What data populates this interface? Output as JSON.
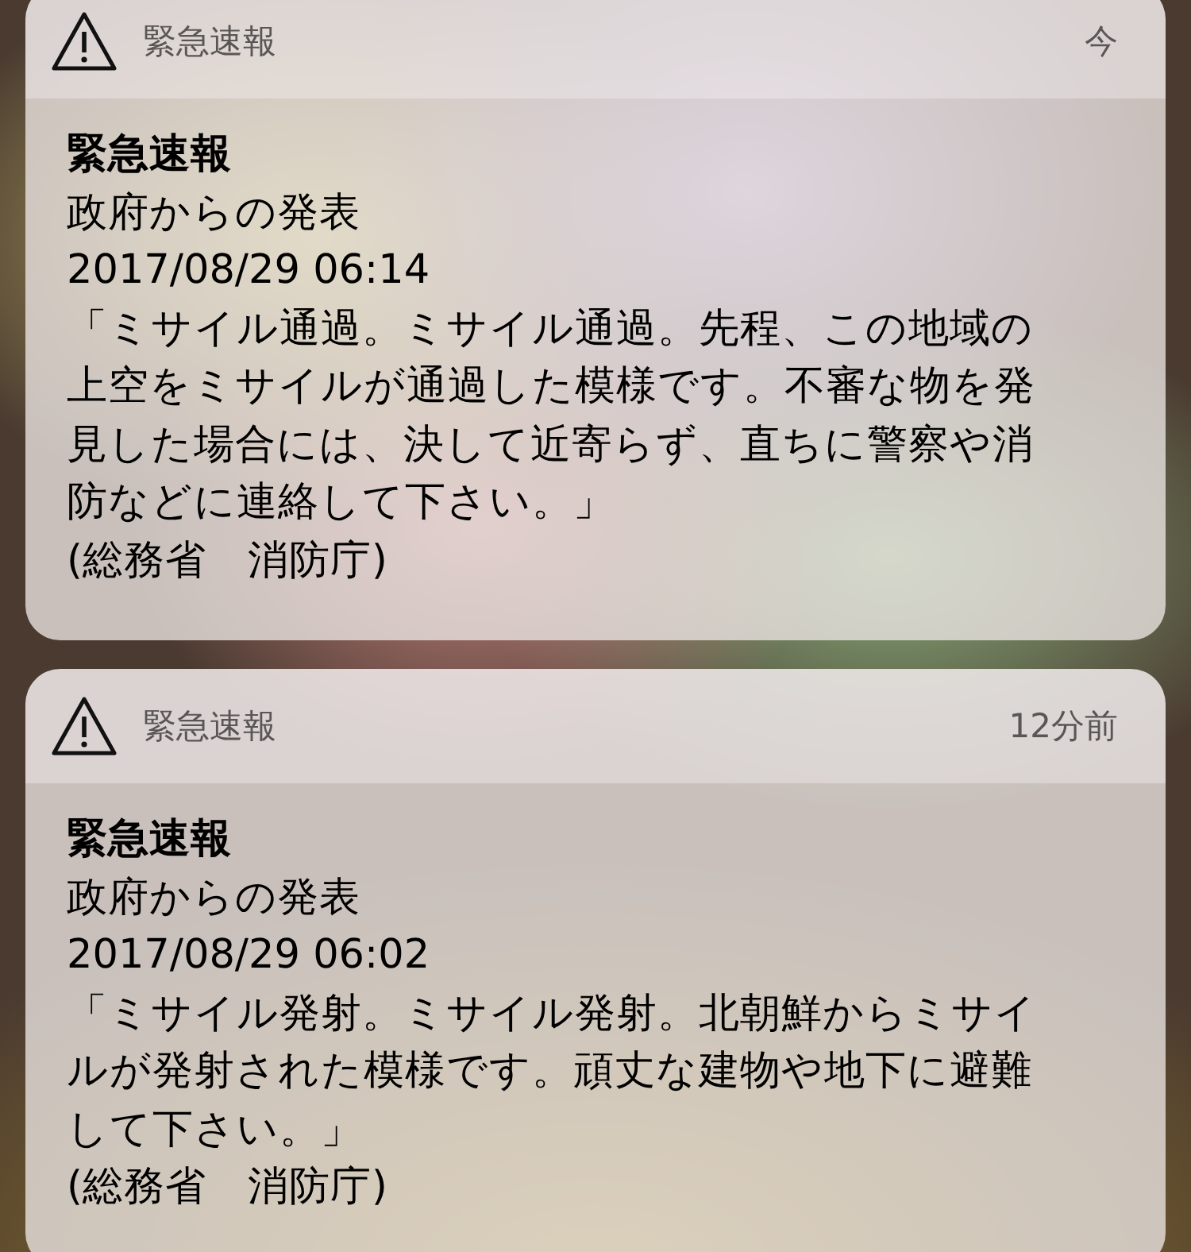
{
  "notifications": [
    {
      "app": "緊急速報",
      "time": "今",
      "title": "緊急速報",
      "subtitle": "政府からの発表",
      "date": "2017/08/29 06:14",
      "message_lines": [
        "「ミサイル通過。ミサイル通過。先程、この地域の",
        "上空をミサイルが通過した模様です。不審な物を発",
        "見した場合には、決して近寄らず、直ちに警察や消",
        "防などに連絡して下さい。」"
      ],
      "source": "(総務省　消防庁)"
    },
    {
      "app": "緊急速報",
      "time": "12分前",
      "title": "緊急速報",
      "subtitle": "政府からの発表",
      "date": "2017/08/29 06:02",
      "message_lines": [
        "「ミサイル発射。ミサイル発射。北朝鮮からミサイ",
        "ルが発射された模様です。頑丈な建物や地下に避難",
        "して下さい。」"
      ],
      "source": "(総務省　消防庁)"
    }
  ]
}
